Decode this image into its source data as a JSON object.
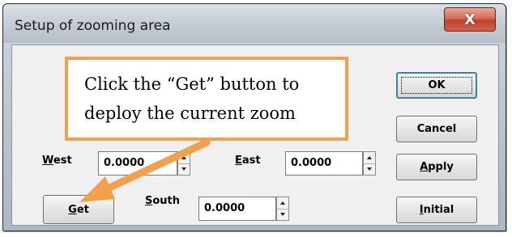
{
  "window": {
    "title": "Setup of zooming area",
    "close_glyph": "X"
  },
  "labels": {
    "west_mnemonic": "W",
    "west_rest": "est",
    "east_mnemonic": "E",
    "east_rest": "ast",
    "south_mnemonic": "S",
    "south_rest": "outh"
  },
  "fields": {
    "west_value": "0.0000",
    "east_value": "0.0000",
    "south_value": "0.0000"
  },
  "buttons": {
    "ok": "OK",
    "cancel": "Cancel",
    "apply_mnemonic": "A",
    "apply_rest": "pply",
    "initial_mnemonic": "I",
    "initial_rest": "nitial",
    "get_mnemonic": "G",
    "get_rest": "et"
  },
  "annotation": {
    "line1": "Click the “Get” button to",
    "line2": "deploy the current zoom",
    "color": "#f2a04c"
  }
}
